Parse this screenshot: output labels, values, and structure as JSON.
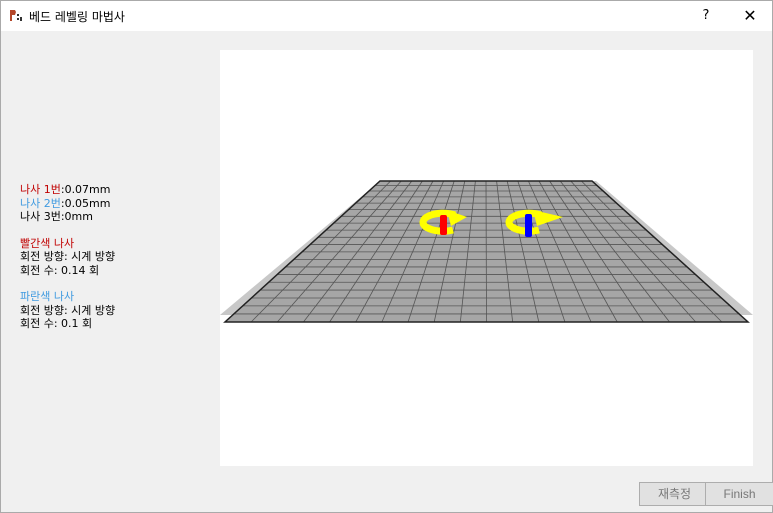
{
  "window": {
    "title": "베드 레벨링 마법사",
    "help_label": "?",
    "close_label": "✕"
  },
  "screws": {
    "screw1_label": "나사 1번",
    "screw1_value": ":0.07mm",
    "screw2_label": "나사 2번",
    "screw2_value": ":0.05mm",
    "screw3_line": "나사 3번:0mm"
  },
  "red_screw": {
    "heading": "빨간색 나사",
    "direction": "회전 방향: 시계 방향",
    "turns": "회전 수: 0.14 회"
  },
  "blue_screw": {
    "heading": "파란색 나사",
    "direction": "회전 방향: 시계 방향",
    "turns": "회전 수: 0.1 회"
  },
  "buttons": {
    "remeasure": "재측정",
    "finish": "Finish"
  },
  "colors": {
    "red_screw": "#ff0000",
    "blue_screw": "#0000ff",
    "arrow": "#ffff00",
    "bed": "#a6a6a6",
    "grid": "#555555"
  },
  "icons": {
    "app": "app-icon",
    "help": "help-icon",
    "close": "close-icon"
  }
}
